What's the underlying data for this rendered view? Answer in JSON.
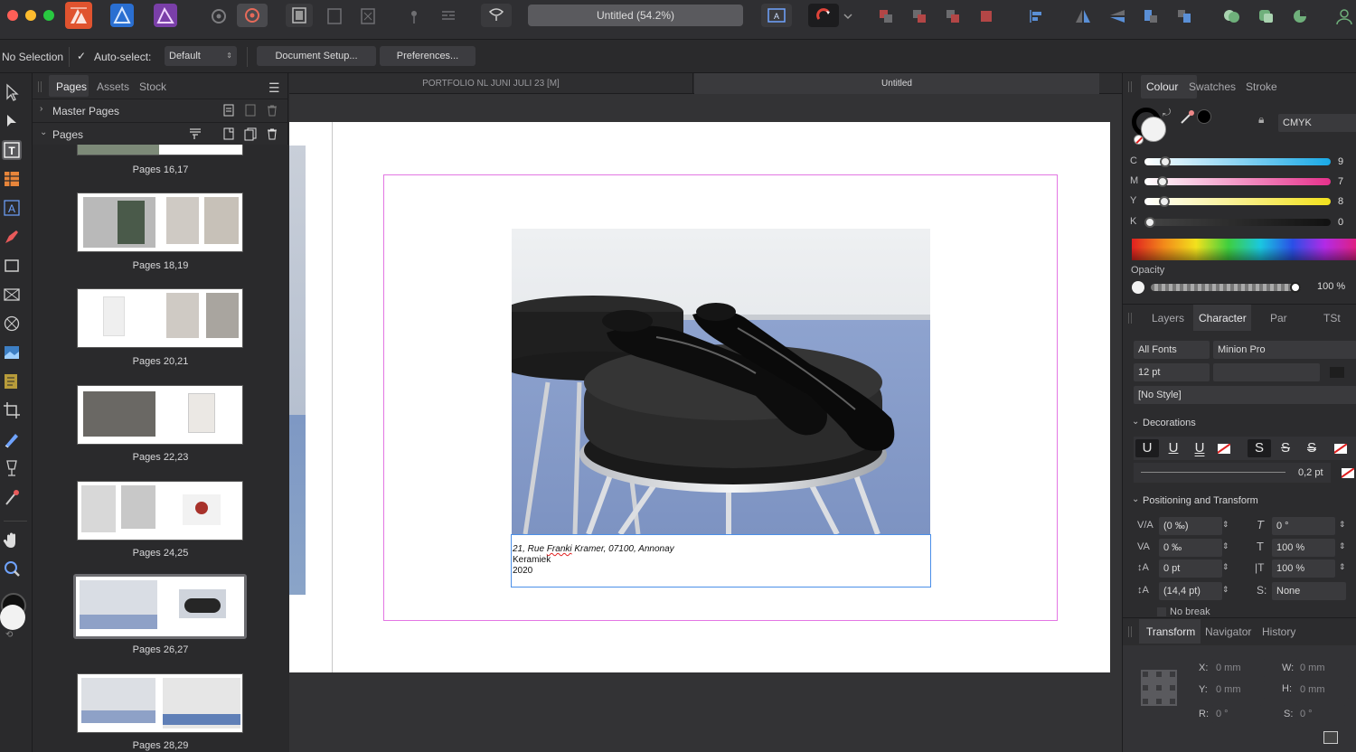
{
  "app": {
    "document_title": "Untitled (54.2%)"
  },
  "context_bar": {
    "selection_label": "No Selection",
    "auto_select_label": "Auto-select:",
    "auto_select_value": "Default",
    "document_setup_label": "Document Setup...",
    "preferences_label": "Preferences..."
  },
  "pages_panel": {
    "tabs": [
      "Pages",
      "Assets",
      "Stock"
    ],
    "master_pages_label": "Master Pages",
    "pages_label": "Pages",
    "spreads": [
      {
        "label": "Pages 16,17"
      },
      {
        "label": "Pages 18,19"
      },
      {
        "label": "Pages 20,21"
      },
      {
        "label": "Pages 22,23"
      },
      {
        "label": "Pages 24,25"
      },
      {
        "label": "Pages 26,27",
        "selected": true
      },
      {
        "label": "Pages 28,29"
      }
    ]
  },
  "document_tabs": [
    {
      "label": "PORTFOLIO NL JUNI JULI 23 [M]",
      "active": false
    },
    {
      "label": "Untitled",
      "active": true
    }
  ],
  "caption": {
    "line1_before": "21, Rue ",
    "line1_misspelled": "Franki",
    "line1_after": " Kramer, 07100, Annonay",
    "line2": "Keramiek",
    "line3": "2020"
  },
  "colour_panel": {
    "tabs": [
      "Colour",
      "Swatches",
      "Stroke"
    ],
    "model": "CMYK",
    "channels": [
      {
        "name": "C",
        "value": "9",
        "fraction": 0.09
      },
      {
        "name": "M",
        "value": "7",
        "fraction": 0.07
      },
      {
        "name": "Y",
        "value": "8",
        "fraction": 0.08
      },
      {
        "name": "K",
        "value": "0",
        "fraction": 0.0
      }
    ],
    "opacity_label": "Opacity",
    "opacity_value": "100 %",
    "opacity_fraction": 1.0
  },
  "character_panel": {
    "tabs": [
      "Layers",
      "Character",
      "Par",
      "TSt"
    ],
    "font_collection": "All Fonts",
    "font_family": "Minion Pro",
    "font_size": "12 pt",
    "style": "[No Style]",
    "decorations_label": "Decorations",
    "decoration_glyphs": [
      "U",
      "U",
      "U",
      "S",
      "S",
      "S"
    ],
    "stroke_width": "0,2 pt",
    "positioning_label": "Positioning and Transform",
    "kerning": "(0 ‰)",
    "tracking": "0 ‰",
    "baseline": "0 pt",
    "leading": "(14,4 pt)",
    "shear": "0 °",
    "height_scale": "100 %",
    "width_scale": "100 %",
    "typographic_case": "None",
    "no_break_label": "No break"
  },
  "transform_panel": {
    "tabs": [
      "Transform",
      "Navigator",
      "History"
    ],
    "x_label": "X:",
    "x_value": "0 mm",
    "y_label": "Y:",
    "y_value": "0 mm",
    "w_label": "W:",
    "w_value": "0 mm",
    "h_label": "H:",
    "h_value": "0 mm",
    "r_label": "R:",
    "r_value": "0 °",
    "s_label": "S:",
    "s_value": "0 °"
  },
  "colors": {
    "accent_pink": "#e377e3",
    "frame_blue": "#4b8fe8",
    "app_icon_orange": "#e0532f"
  }
}
